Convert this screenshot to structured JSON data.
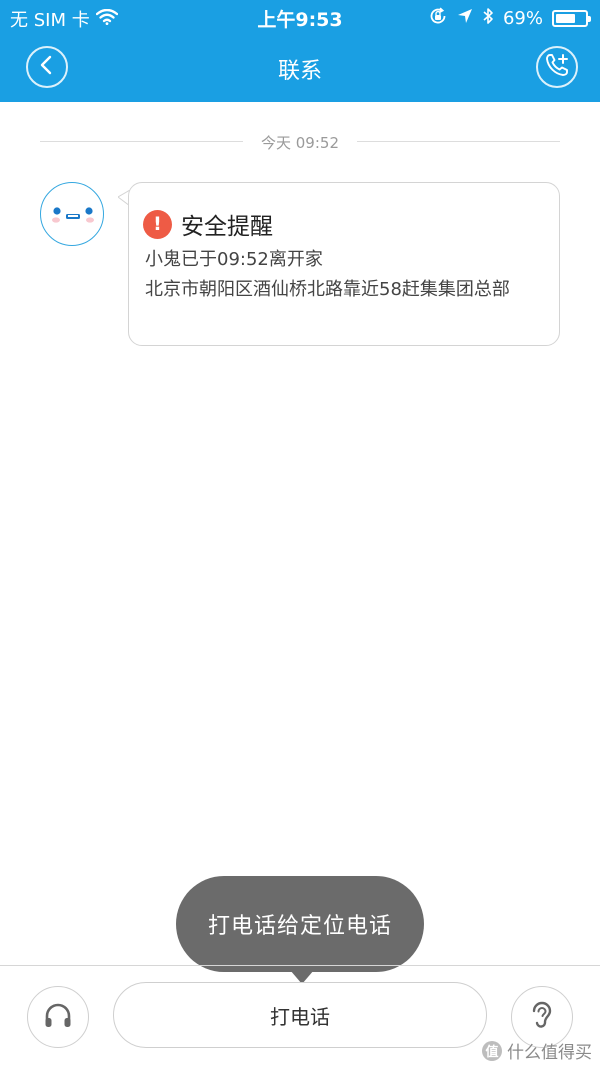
{
  "status_bar": {
    "carrier": "无 SIM 卡",
    "time": "上午9:53",
    "battery": "69%",
    "battery_level": 0.69
  },
  "nav": {
    "title": "联系",
    "back_icon": "chevron-left-icon",
    "call_icon": "phone-add-icon"
  },
  "chat": {
    "time_divider": "今天 09:52",
    "message": {
      "alert_icon": "!",
      "title": "安全提醒",
      "line1": "小鬼已于09:52离开家",
      "address": "北京市朝阳区酒仙桥北路靠近58赶集集团总部"
    }
  },
  "tooltip": {
    "text": "打电话给定位电话"
  },
  "bottom": {
    "call_label": "打电话"
  },
  "watermark": {
    "logo": "值",
    "text": "什么值得买"
  },
  "colors": {
    "header": "#1a9fe3",
    "alert": "#ee5b45",
    "tooltip": "#6b6b6b"
  }
}
